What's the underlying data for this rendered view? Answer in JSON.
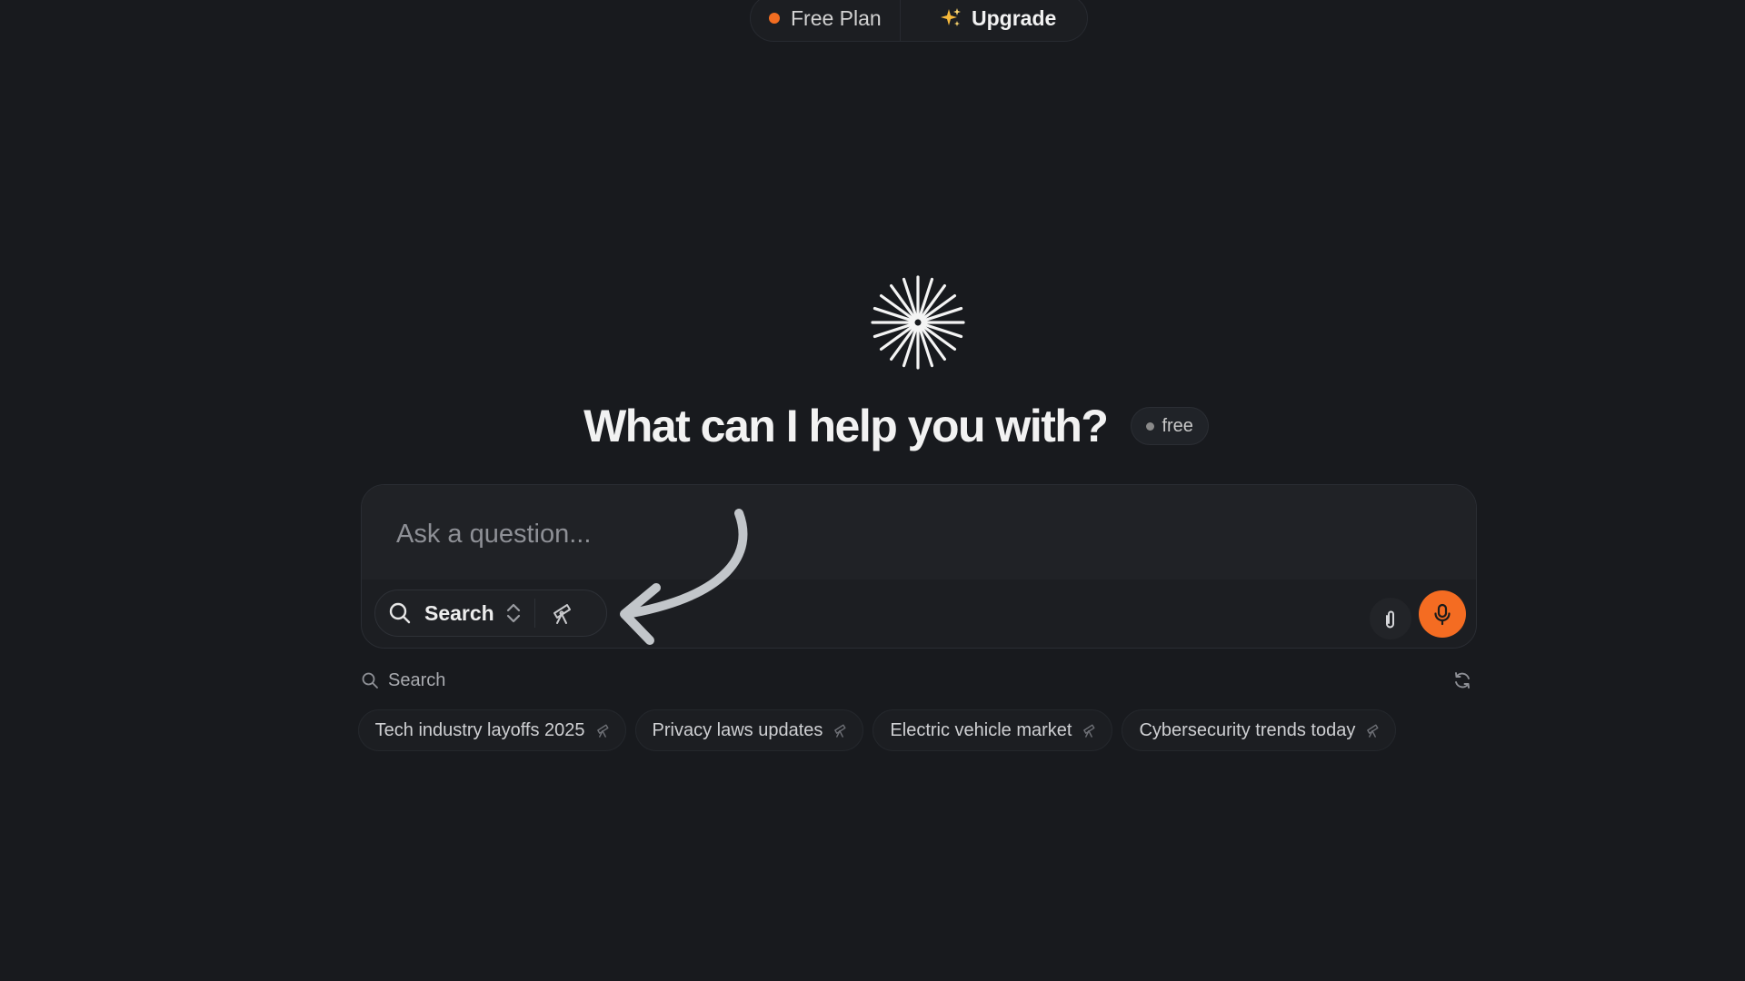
{
  "plan": {
    "current_label": "Free Plan",
    "upgrade_label": "Upgrade",
    "accent_color": "#f26d21"
  },
  "hero": {
    "headline": "What can I help you with?",
    "badge_label": "free",
    "logo_icon": "starburst-icon"
  },
  "composer": {
    "placeholder": "Ask a question...",
    "value": "",
    "mode_label": "Search",
    "mode_icon": "search-icon",
    "alt_mode_icon": "telescope-icon",
    "attach_icon": "paperclip-icon",
    "mic_icon": "microphone-icon",
    "mic_color": "#f46c22"
  },
  "suggestions": {
    "header_label": "Search",
    "refresh_icon": "refresh-icon",
    "items": [
      {
        "label": "Tech industry layoffs 2025"
      },
      {
        "label": "Privacy laws updates"
      },
      {
        "label": "Electric vehicle market"
      },
      {
        "label": "Cybersecurity trends today"
      }
    ]
  }
}
